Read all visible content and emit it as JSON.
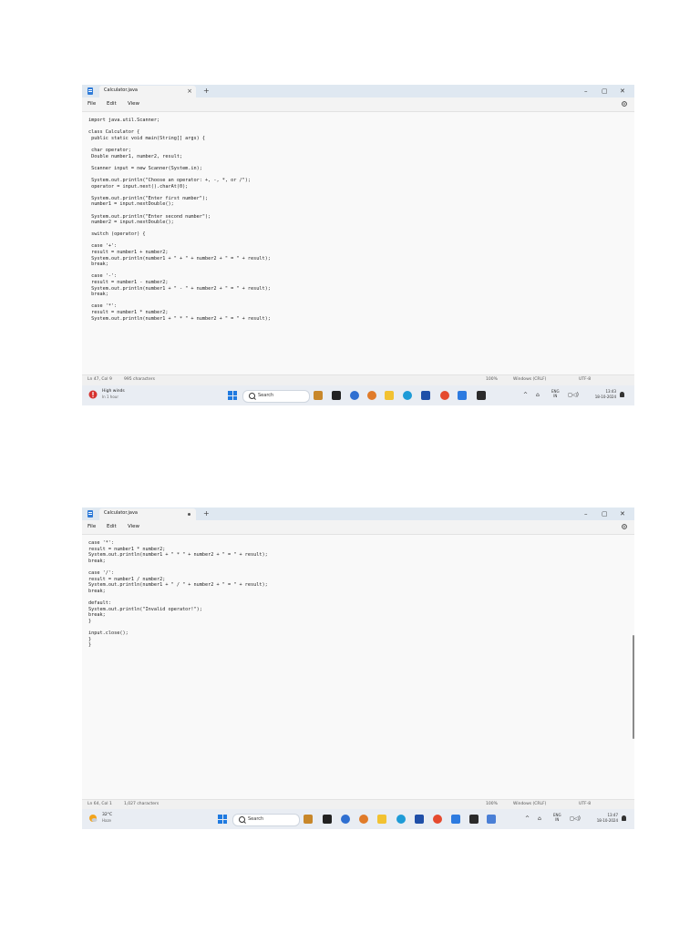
{
  "screenshots": [
    {
      "tab_title": "Calculator.java",
      "tab_control": "close",
      "new_tab": "+",
      "window_controls": {
        "minimize": "–",
        "maximize": "▢",
        "close": "✕"
      },
      "menu": {
        "file": "File",
        "edit": "Edit",
        "view": "View"
      },
      "code": "import java.util.Scanner;\n\nclass Calculator {\n public static void main(String[] args) {\n\n char operator;\n Double number1, number2, result;\n\n Scanner input = new Scanner(System.in);\n\n System.out.println(\"Choose an operator: +, -, *, or /\");\n operator = input.next().charAt(0);\n\n System.out.println(\"Enter first number\");\n number1 = input.nextDouble();\n\n System.out.println(\"Enter second number\");\n number2 = input.nextDouble();\n\n switch (operator) {\n\n case '+':\n result = number1 + number2;\n System.out.println(number1 + \" + \" + number2 + \" = \" + result);\n break;\n\n case '-':\n result = number1 - number2;\n System.out.println(number1 + \" - \" + number2 + \" = \" + result);\n break;\n\n case '*':\n result = number1 * number2;\n System.out.println(number1 + \" * \" + number2 + \" = \" + result);",
      "status": {
        "position": "Ln 47, Col 9",
        "characters": "995 characters",
        "zoom": "100%",
        "line_ending": "Windows (CRLF)",
        "encoding": "UTF-8"
      },
      "taskbar": {
        "weather_title": "High winds",
        "weather_sub": "In 1 hour",
        "search_label": "Search",
        "lang_top": "ENG",
        "lang_bottom": "IN",
        "time": "13:43",
        "date": "18-10-2024"
      }
    },
    {
      "tab_title": "Calculator.java",
      "tab_control": "unsaved-dot",
      "new_tab": "+",
      "window_controls": {
        "minimize": "–",
        "maximize": "▢",
        "close": "✕"
      },
      "menu": {
        "file": "File",
        "edit": "Edit",
        "view": "View"
      },
      "code": "case '*':\nresult = number1 * number2;\nSystem.out.println(number1 + \" * \" + number2 + \" = \" + result);\nbreak;\n\ncase '/':\nresult = number1 / number2;\nSystem.out.println(number1 + \" / \" + number2 + \" = \" + result);\nbreak;\n\ndefault:\nSystem.out.println(\"Invalid operator!\");\nbreak;\n}\n\ninput.close();\n}\n}",
      "status": {
        "position": "Ln 64, Col 1",
        "characters": "1,027 characters",
        "zoom": "100%",
        "line_ending": "Windows (CRLF)",
        "encoding": "UTF-8"
      },
      "taskbar": {
        "weather_title": "32°C",
        "weather_sub": "Haze",
        "search_label": "Search",
        "lang_top": "ENG",
        "lang_bottom": "IN",
        "time": "13:47",
        "date": "18-10-2024"
      }
    }
  ],
  "colors": {
    "accent": "#1f7ae0",
    "titlebar": "#dfe8f1",
    "editor_bg": "#f9f9f9",
    "taskbar": "#e9edf3"
  },
  "icons": [
    "notepad-icon",
    "gear-icon",
    "weather-icon",
    "windows-start-icon",
    "search-icon",
    "task-view-icon",
    "file-explorer-icon",
    "edge-icon",
    "chrome-icon",
    "store-icon",
    "terminal-icon",
    "chevron-up-icon",
    "network-icon",
    "volume-icon",
    "notification-bell-icon"
  ]
}
